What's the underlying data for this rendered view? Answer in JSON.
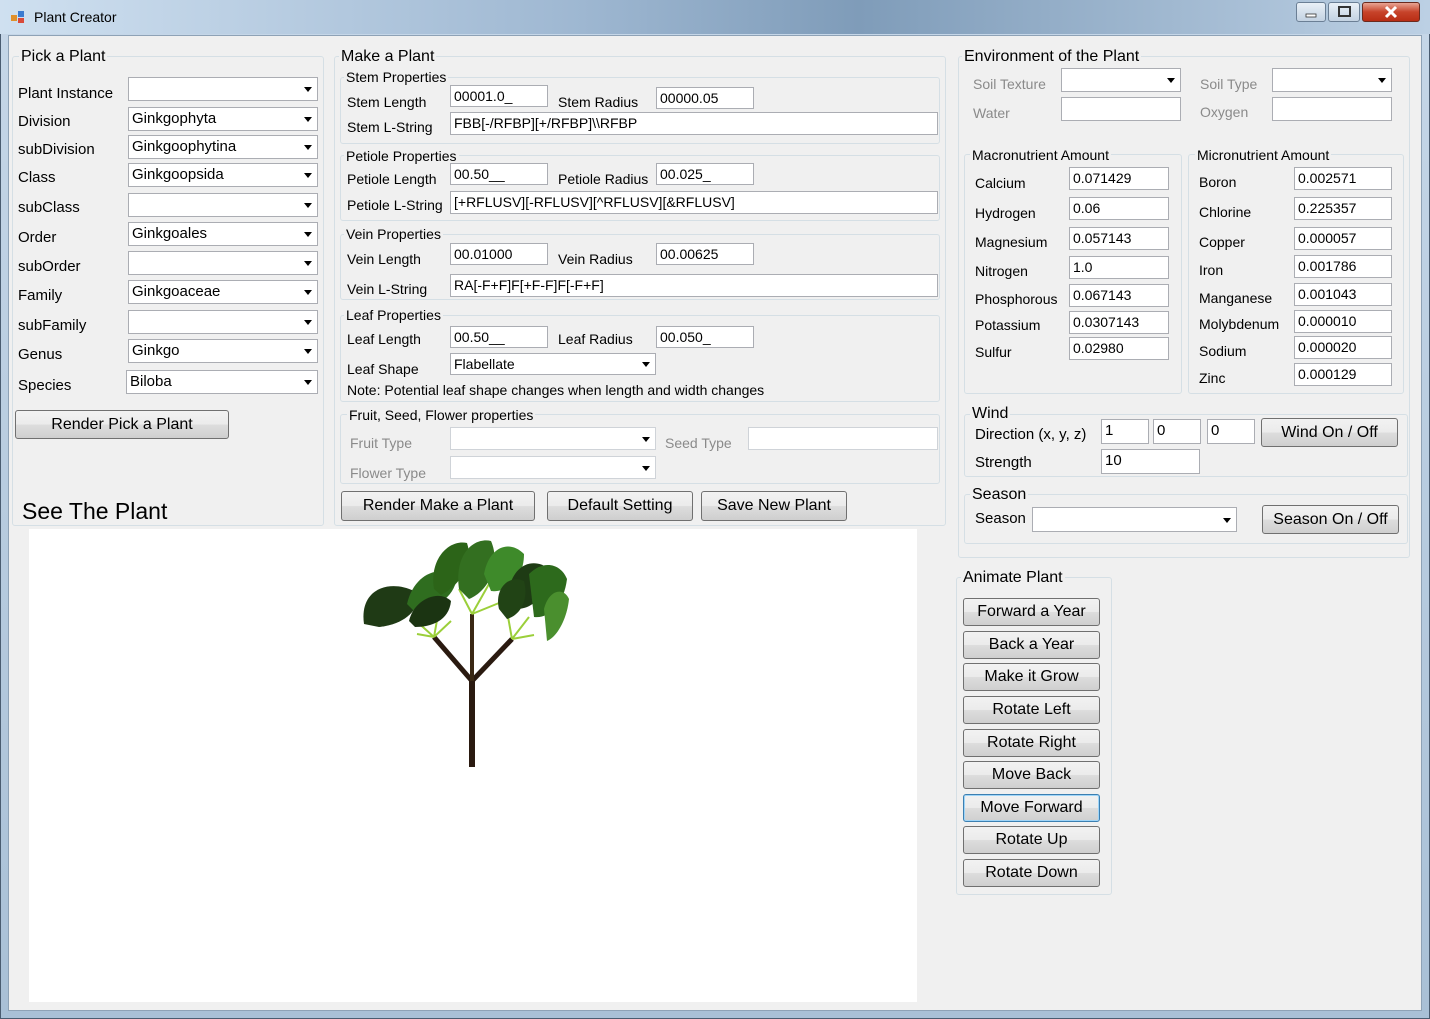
{
  "window": {
    "title": "Plant Creator"
  },
  "pick": {
    "title": "Pick a Plant",
    "fields": [
      {
        "label": "Plant Instance",
        "value": ""
      },
      {
        "label": "Division",
        "value": "Ginkgophyta"
      },
      {
        "label": "subDivision",
        "value": "Ginkgoophytina"
      },
      {
        "label": "Class",
        "value": "Ginkgoopsida"
      },
      {
        "label": "subClass",
        "value": ""
      },
      {
        "label": "Order",
        "value": "Ginkgoales"
      },
      {
        "label": "subOrder",
        "value": ""
      },
      {
        "label": "Family",
        "value": "Ginkgoaceae"
      },
      {
        "label": "subFamily",
        "value": ""
      },
      {
        "label": "Genus",
        "value": "Ginkgo"
      },
      {
        "label": "Species",
        "value": "Biloba"
      }
    ],
    "render_button": "Render Pick a Plant"
  },
  "see": {
    "title": "See The Plant"
  },
  "make": {
    "title": "Make a Plant",
    "stem": {
      "title": "Stem Properties",
      "length_label": "Stem Length",
      "length_value": "00001.0_",
      "radius_label": "Stem Radius",
      "radius_value": "00000.05",
      "lstring_label": "Stem L-String",
      "lstring_value": "FBB[-/RFBP][+/RFBP]\\\\RFBP"
    },
    "petiole": {
      "title": "Petiole Properties",
      "length_label": "Petiole Length",
      "length_value": "00.50__",
      "radius_label": "Petiole Radius",
      "radius_value": "00.025_",
      "lstring_label": "Petiole L-String",
      "lstring_value": "[+RFLUSV][-RFLUSV][^RFLUSV][&RFLUSV]"
    },
    "vein": {
      "title": "Vein Properties",
      "length_label": "Vein Length",
      "length_value": "00.01000",
      "radius_label": "Vein Radius",
      "radius_value": "00.00625",
      "lstring_label": "Vein L-String",
      "lstring_value": "RA[-F+F]F[+F-F]F[-F+F]"
    },
    "leaf": {
      "title": "Leaf Properties",
      "length_label": "Leaf Length",
      "length_value": "00.50__",
      "radius_label": "Leaf Radius",
      "radius_value": "00.050_",
      "shape_label": "Leaf Shape",
      "shape_value": "Flabellate",
      "note": "Note: Potential leaf shape changes when length and width changes"
    },
    "fruit": {
      "title": "Fruit, Seed, Flower properties",
      "fruit_label": "Fruit Type",
      "fruit_value": "",
      "seed_label": "Seed Type",
      "seed_value": "",
      "flower_label": "Flower Type",
      "flower_value": ""
    },
    "buttons": {
      "render": "Render Make a Plant",
      "default": "Default Setting",
      "save": "Save New Plant"
    }
  },
  "env": {
    "title": "Environment of the Plant",
    "soil_texture_label": "Soil Texture",
    "soil_texture_value": "",
    "soil_type_label": "Soil Type",
    "soil_type_value": "",
    "water_label": "Water",
    "water_value": "",
    "oxygen_label": "Oxygen",
    "oxygen_value": "",
    "macro": {
      "title": "Macronutrient Amount",
      "items": [
        {
          "label": "Calcium",
          "value": "0.071429"
        },
        {
          "label": "Hydrogen",
          "value": "0.06"
        },
        {
          "label": "Magnesium",
          "value": "0.057143"
        },
        {
          "label": "Nitrogen",
          "value": "1.0"
        },
        {
          "label": "Phosphorous",
          "value": "0.067143"
        },
        {
          "label": "Potassium",
          "value": "0.0307143"
        },
        {
          "label": "Sulfur",
          "value": "0.02980"
        }
      ]
    },
    "micro": {
      "title": "Micronutrient Amount",
      "items": [
        {
          "label": "Boron",
          "value": "0.002571"
        },
        {
          "label": "Chlorine",
          "value": "0.225357"
        },
        {
          "label": "Copper",
          "value": "0.000057"
        },
        {
          "label": "Iron",
          "value": "0.001786"
        },
        {
          "label": "Manganese",
          "value": "0.001043"
        },
        {
          "label": "Molybdenum",
          "value": "0.000010"
        },
        {
          "label": "Sodium",
          "value": "0.000020"
        },
        {
          "label": "Zinc",
          "value": "0.000129"
        }
      ]
    },
    "wind": {
      "title": "Wind",
      "direction_label": "Direction (x, y, z)",
      "x": "1",
      "y": "0",
      "z": "0",
      "strength_label": "Strength",
      "strength": "10",
      "toggle": "Wind On / Off"
    },
    "season": {
      "title": "Season",
      "label": "Season",
      "value": "",
      "toggle": "Season On / Off"
    }
  },
  "animate": {
    "title": "Animate Plant",
    "buttons": [
      "Forward a Year",
      "Back a Year",
      "Make it Grow",
      "Rotate Left",
      "Rotate Right",
      "Move Back",
      "Move Forward",
      "Rotate Up",
      "Rotate Down"
    ]
  }
}
